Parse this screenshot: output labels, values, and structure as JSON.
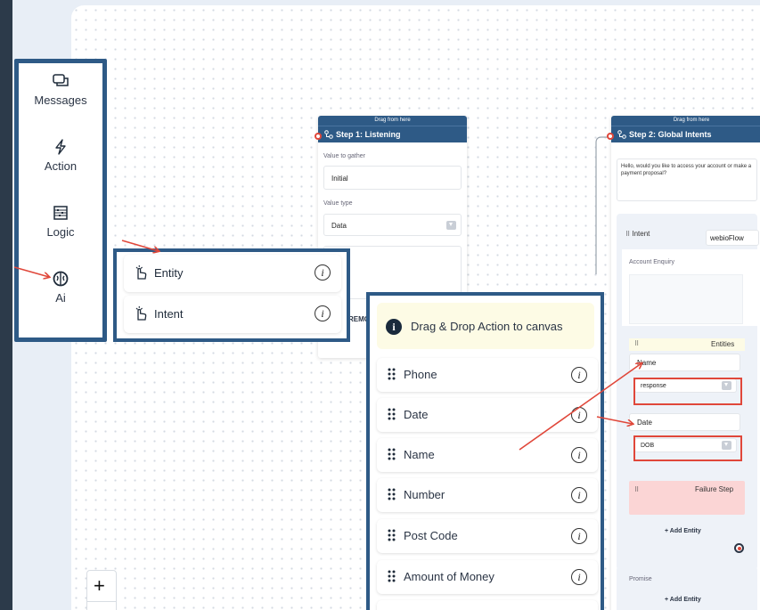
{
  "sidebar": {
    "items": [
      {
        "label": "Messages",
        "icon": "messages-icon"
      },
      {
        "label": "Action",
        "icon": "lightning-icon"
      },
      {
        "label": "Logic",
        "icon": "abacus-icon"
      },
      {
        "label": "Ai",
        "icon": "brain-icon"
      }
    ]
  },
  "ai_panel": {
    "items": [
      {
        "label": "Entity",
        "icon": "hand-pointer-icon"
      },
      {
        "label": "Intent",
        "icon": "hand-pointer-icon"
      }
    ]
  },
  "step1": {
    "drag": "Drag from here",
    "title": "Step 1: Listening",
    "value_label": "Value to gather",
    "value": "Initial",
    "type_label": "Value type",
    "type_value": "Data",
    "remove_text": "REMO"
  },
  "step2": {
    "drag": "Drag from here",
    "title": "Step 2: Global Intents",
    "message": "Hello, would you like to access your account or make a payment proposal?",
    "intent_label": "Intent",
    "intent_select": "webioFlow",
    "intent_name": "Account Enquiry",
    "entities_label": "Entities",
    "entity1_name": "Name",
    "entity1_value": "response",
    "entity2_name": "Date",
    "entity2_value": "DOB",
    "failure_label": "Failure Step",
    "add_entity": "+ Add Entity",
    "promise_label": "Promise",
    "add_entity2": "+ Add Entity"
  },
  "actions": {
    "hint": "Drag & Drop Action to canvas",
    "items": [
      "Phone",
      "Date",
      "Name",
      "Number",
      "Post Code",
      "Amount of Money"
    ]
  },
  "zoom": {
    "plus": "+"
  },
  "colors": {
    "accent": "#2e5a86",
    "annotation": "#e0473a",
    "failure_bg": "#fbd5d5"
  }
}
